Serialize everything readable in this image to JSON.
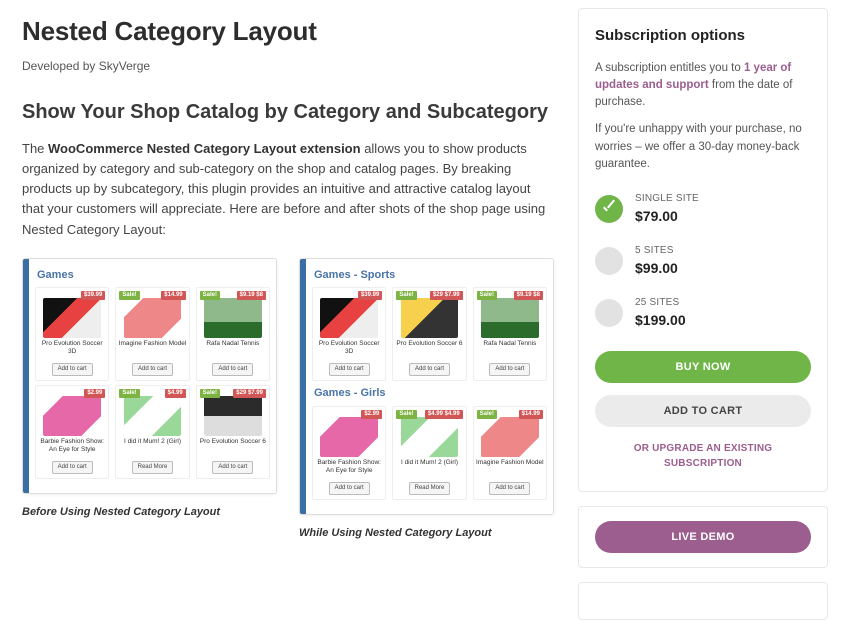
{
  "header": {
    "title": "Nested Category Layout",
    "developed_prefix": "Developed by ",
    "developer": "SkyVerge"
  },
  "main": {
    "heading": "Show Your Shop Catalog by Category and Subcategory",
    "desc_prefix": "The ",
    "desc_bold": "WooCommerce Nested Category Layout extension",
    "desc_rest": " allows you to show products organized by category and sub-category on the shop and catalog pages. By breaking products up by subcategory, this plugin provides an intuitive and attractive catalog layout that your customers will appreciate. Here are before and after shots of the shop page using Nested Category Layout:"
  },
  "shots": {
    "before": {
      "caption": "Before Using Nested Category Layout",
      "sections": [
        {
          "title": "Games",
          "rows": [
            [
              {
                "title": "Pro Evolution Soccer 3D",
                "btn": "Add to cart",
                "thumb": "pes",
                "sale": "",
                "price": "$39.99"
              },
              {
                "title": "Imagine Fashion Model",
                "btn": "Add to cart",
                "thumb": "fashion",
                "sale": "Sale!",
                "price": "$14.99"
              },
              {
                "title": "Rafa Nadal Tennis",
                "btn": "Add to cart",
                "thumb": "rafa",
                "sale": "Sale!",
                "price": "$9.19 $8"
              }
            ],
            [
              {
                "title": "Barbie Fashion Show: An Eye for Style",
                "btn": "Add to cart",
                "thumb": "barbie",
                "sale": "",
                "price": "$2.99"
              },
              {
                "title": "I did it Mum! 2 (Girl)",
                "btn": "Read More",
                "thumb": "mum",
                "sale": "Sale!",
                "price": "$4.99"
              },
              {
                "title": "Pro Evolution Soccer 6",
                "btn": "Add to cart",
                "thumb": "pes2",
                "sale": "Sale!",
                "price": "$29 $7.99"
              }
            ]
          ]
        }
      ]
    },
    "after": {
      "caption": "While Using Nested Category Layout",
      "sections": [
        {
          "title": "Games - Sports",
          "rows": [
            [
              {
                "title": "Pro Evolution Soccer 3D",
                "btn": "Add to cart",
                "thumb": "pes",
                "sale": "",
                "price": "$39.99"
              },
              {
                "title": "Pro Evolution Soccer 6",
                "btn": "Add to cart",
                "thumb": "pes3",
                "sale": "Sale!",
                "price": "$29 $7.99"
              },
              {
                "title": "Rafa Nadal Tennis",
                "btn": "Add to cart",
                "thumb": "rafa",
                "sale": "Sale!",
                "price": "$9.19 $8"
              }
            ]
          ]
        },
        {
          "title": "Games - Girls",
          "rows": [
            [
              {
                "title": "Barbie Fashion Show: An Eye for Style",
                "btn": "Add to cart",
                "thumb": "barbie",
                "sale": "",
                "price": "$2.99"
              },
              {
                "title": "I did it Mum! 2 (Girl)",
                "btn": "Read More",
                "thumb": "mum",
                "sale": "Sale!",
                "price": "$4.99 $4.99"
              },
              {
                "title": "Imagine Fashion Model",
                "btn": "Add to cart",
                "thumb": "fashion",
                "sale": "Sale!",
                "price": "$14.99"
              }
            ]
          ]
        }
      ]
    }
  },
  "sidebar": {
    "heading": "Subscription options",
    "blurb1_prefix": "A subscription entitles you to ",
    "blurb1_bold": "1 year of updates and support",
    "blurb1_suffix": " from the date of purchase.",
    "blurb2": "If you're unhappy with your purchase, no worries – we offer a 30-day money-back guarantee.",
    "tiers": [
      {
        "label": "SINGLE SITE",
        "price": "$79.00",
        "selected": true
      },
      {
        "label": "5 SITES",
        "price": "$99.00",
        "selected": false
      },
      {
        "label": "25 SITES",
        "price": "$199.00",
        "selected": false
      }
    ],
    "buy": "BUY NOW",
    "cart": "ADD TO CART",
    "upgrade": "OR UPGRADE AN EXISTING SUBSCRIPTION",
    "demo": "LIVE DEMO"
  }
}
